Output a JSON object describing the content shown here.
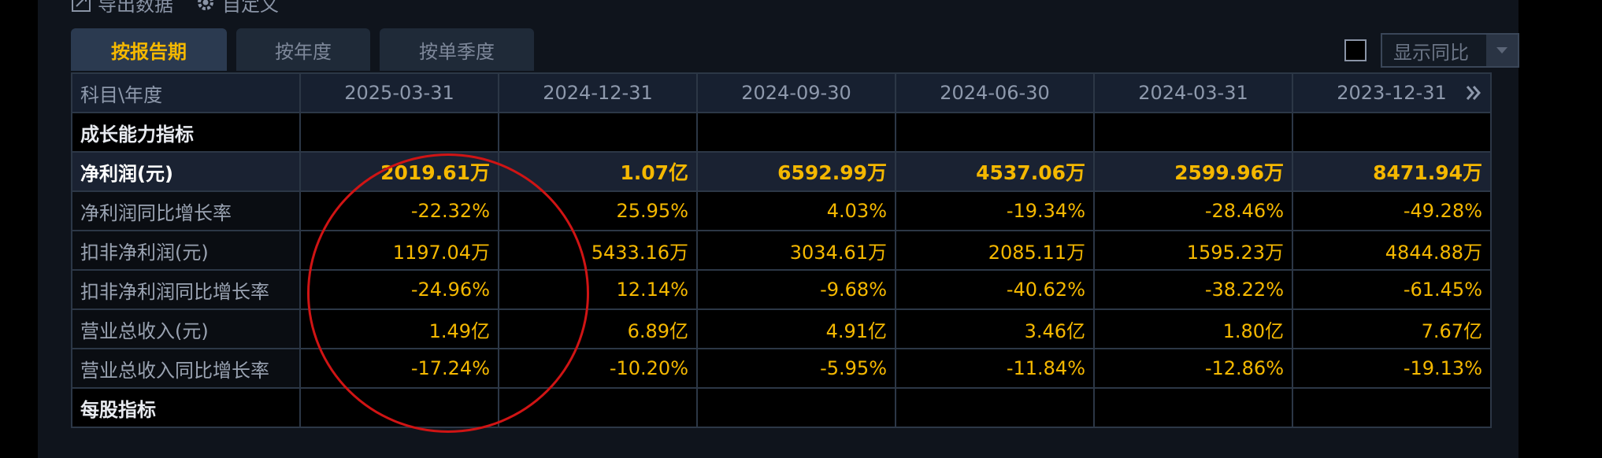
{
  "toolbar": {
    "export_label": "导出数据",
    "custom_label": "自定义",
    "export_icon": "export-icon",
    "custom_icon": "gear-icon"
  },
  "tabs": [
    {
      "label": "按报告期",
      "active": true
    },
    {
      "label": "按年度",
      "active": false
    },
    {
      "label": "按单季度",
      "active": false
    }
  ],
  "compare": {
    "label": "显示同比",
    "checked": false
  },
  "table": {
    "header_label": "科目\\年度",
    "periods": [
      "2025-03-31",
      "2024-12-31",
      "2024-09-30",
      "2024-06-30",
      "2024-03-31",
      "2023-12-31"
    ],
    "rows": [
      {
        "label": "成长能力指标",
        "type": "section",
        "values": [
          "",
          "",
          "",
          "",
          "",
          ""
        ]
      },
      {
        "label": "净利润(元)",
        "type": "highlight",
        "values": [
          "2019.61万",
          "1.07亿",
          "6592.99万",
          "4537.06万",
          "2599.96万",
          "8471.94万"
        ]
      },
      {
        "label": "净利润同比增长率",
        "type": "data",
        "values": [
          "-22.32%",
          "25.95%",
          "4.03%",
          "-19.34%",
          "-28.46%",
          "-49.28%"
        ]
      },
      {
        "label": "扣非净利润(元)",
        "type": "data",
        "values": [
          "1197.04万",
          "5433.16万",
          "3034.61万",
          "2085.11万",
          "1595.23万",
          "4844.88万"
        ]
      },
      {
        "label": "扣非净利润同比增长率",
        "type": "data",
        "values": [
          "-24.96%",
          "12.14%",
          "-9.68%",
          "-40.62%",
          "-38.22%",
          "-61.45%"
        ]
      },
      {
        "label": "营业总收入(元)",
        "type": "data",
        "values": [
          "1.49亿",
          "6.89亿",
          "4.91亿",
          "3.46亿",
          "1.80亿",
          "7.67亿"
        ]
      },
      {
        "label": "营业总收入同比增长率",
        "type": "data",
        "values": [
          "-17.24%",
          "-10.20%",
          "-5.95%",
          "-11.84%",
          "-12.86%",
          "-19.13%"
        ]
      },
      {
        "label": "每股指标",
        "type": "section",
        "values": [
          "",
          "",
          "",
          "",
          "",
          ""
        ]
      }
    ]
  },
  "colors": {
    "value": "#f5b800",
    "annotation": "#d01414",
    "background": "#0f141c"
  }
}
